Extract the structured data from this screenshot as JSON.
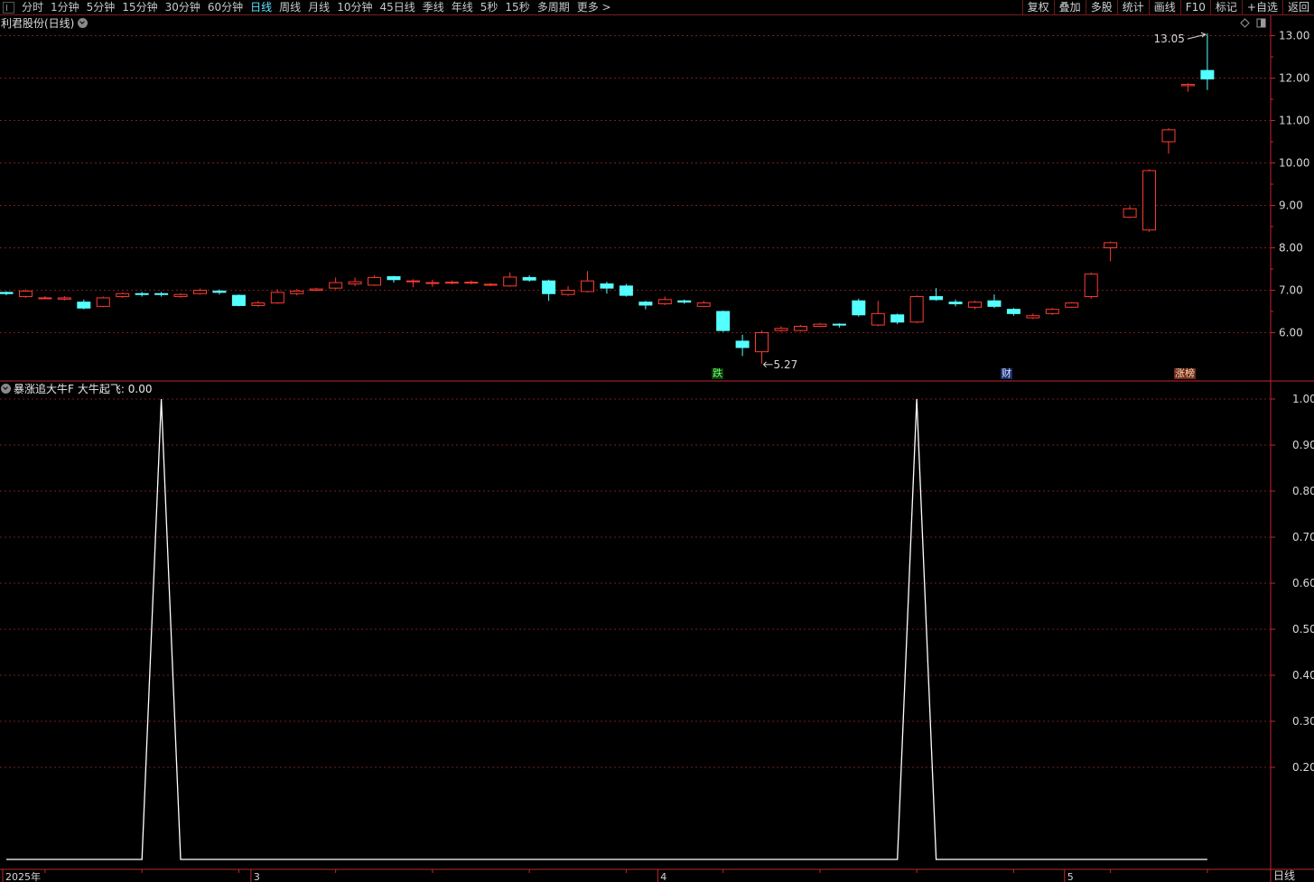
{
  "toolbar": {
    "periods": [
      "分时",
      "1分钟",
      "5分钟",
      "15分钟",
      "30分钟",
      "60分钟",
      "日线",
      "周线",
      "月线",
      "10分钟",
      "45日线",
      "季线",
      "年线",
      "5秒",
      "15秒",
      "多周期",
      "更多 >"
    ],
    "active_period": "日线",
    "buttons": [
      "复权",
      "叠加",
      "多股",
      "统计",
      "画线",
      "F10",
      "标记",
      "+自选",
      "返回"
    ]
  },
  "main_panel": {
    "title": "利君股份(日线)"
  },
  "indicator_panel": {
    "name": "暴涨追大牛F",
    "line_label": "大牛起飞: 0.00"
  },
  "bottom_period_label": "日线",
  "colors": {
    "up": "#ff3b30",
    "down": "#54ffff",
    "grid": "#7a1c1c",
    "axis": "#c0282b",
    "line": "#ffffff"
  },
  "chart_data": [
    {
      "type": "candlestick",
      "title": "利君股份(日线)",
      "ylim": [
        5.0,
        13.2
      ],
      "y_ticks": [
        "6.00",
        "7.00",
        "8.00",
        "9.00",
        "10.00",
        "11.00",
        "12.00",
        "13.00"
      ],
      "max_label": "13.05",
      "min_label": "5.27",
      "signals": [
        {
          "index": 37,
          "label": "跌"
        },
        {
          "index": 52,
          "label": "财"
        },
        {
          "index": 61,
          "label": "涨榜"
        }
      ],
      "candles": [
        [
          6.95,
          6.92,
          6.97,
          6.88
        ],
        [
          6.85,
          6.98,
          7.02,
          6.82
        ],
        [
          6.82,
          6.82,
          6.86,
          6.79
        ],
        [
          6.79,
          6.82,
          6.86,
          6.76
        ],
        [
          6.72,
          6.58,
          6.78,
          6.55
        ],
        [
          6.62,
          6.82,
          6.85,
          6.6
        ],
        [
          6.85,
          6.92,
          6.95,
          6.82
        ],
        [
          6.92,
          6.9,
          6.96,
          6.85
        ],
        [
          6.92,
          6.9,
          6.96,
          6.85
        ],
        [
          6.85,
          6.9,
          6.93,
          6.82
        ],
        [
          6.92,
          7.0,
          7.04,
          6.9
        ],
        [
          6.98,
          6.95,
          7.02,
          6.9
        ],
        [
          6.88,
          6.64,
          6.9,
          6.62
        ],
        [
          6.64,
          6.7,
          6.75,
          6.61
        ],
        [
          6.7,
          6.95,
          7.02,
          6.68
        ],
        [
          6.92,
          6.98,
          7.03,
          6.88
        ],
        [
          7.0,
          7.03,
          7.06,
          6.98
        ],
        [
          7.05,
          7.18,
          7.3,
          7.02
        ],
        [
          7.15,
          7.2,
          7.3,
          7.1
        ],
        [
          7.12,
          7.3,
          7.35,
          7.1
        ],
        [
          7.32,
          7.25,
          7.34,
          7.18
        ],
        [
          7.2,
          7.22,
          7.26,
          7.07
        ],
        [
          7.18,
          7.18,
          7.25,
          7.08
        ],
        [
          7.18,
          7.19,
          7.23,
          7.14
        ],
        [
          7.18,
          7.19,
          7.23,
          7.14
        ],
        [
          7.12,
          7.14,
          7.17,
          7.1
        ],
        [
          7.1,
          7.31,
          7.42,
          7.08
        ],
        [
          7.3,
          7.24,
          7.35,
          7.2
        ],
        [
          7.22,
          6.92,
          7.25,
          6.75
        ],
        [
          6.9,
          7.0,
          7.1,
          6.87
        ],
        [
          6.97,
          7.22,
          7.45,
          6.95
        ],
        [
          7.15,
          7.05,
          7.2,
          6.92
        ],
        [
          7.1,
          6.88,
          7.15,
          6.85
        ],
        [
          6.72,
          6.65,
          6.75,
          6.55
        ],
        [
          6.68,
          6.78,
          6.85,
          6.65
        ],
        [
          6.75,
          6.72,
          6.78,
          6.68
        ],
        [
          6.62,
          6.7,
          6.75,
          6.6
        ],
        [
          6.5,
          6.05,
          6.52,
          6.02
        ],
        [
          5.8,
          5.65,
          5.95,
          5.45
        ],
        [
          5.55,
          6.0,
          6.05,
          5.27
        ],
        [
          6.05,
          6.1,
          6.15,
          6.02
        ],
        [
          6.05,
          6.15,
          6.18,
          6.03
        ],
        [
          6.15,
          6.2,
          6.23,
          6.13
        ],
        [
          6.2,
          6.18,
          6.22,
          6.12
        ],
        [
          6.75,
          6.42,
          6.8,
          6.38
        ],
        [
          6.18,
          6.45,
          6.75,
          6.15
        ],
        [
          6.42,
          6.25,
          6.45,
          6.2
        ],
        [
          6.25,
          6.85,
          6.88,
          6.22
        ],
        [
          6.85,
          6.78,
          7.05,
          6.75
        ],
        [
          6.72,
          6.68,
          6.78,
          6.62
        ],
        [
          6.6,
          6.72,
          6.75,
          6.55
        ],
        [
          6.75,
          6.62,
          6.9,
          6.58
        ],
        [
          6.55,
          6.45,
          6.58,
          6.4
        ],
        [
          6.35,
          6.4,
          6.45,
          6.32
        ],
        [
          6.45,
          6.55,
          6.58,
          6.42
        ],
        [
          6.6,
          6.7,
          6.72,
          6.58
        ],
        [
          6.85,
          7.38,
          7.42,
          6.8
        ],
        [
          8.0,
          8.12,
          8.15,
          7.68
        ],
        [
          8.72,
          8.92,
          8.98,
          8.7
        ],
        [
          8.42,
          9.82,
          9.85,
          8.38
        ],
        [
          10.5,
          10.78,
          10.82,
          10.22
        ],
        [
          11.82,
          11.85,
          11.88,
          11.68
        ],
        [
          12.18,
          11.98,
          13.05,
          11.72
        ]
      ]
    },
    {
      "type": "line",
      "title": "暴涨追大牛F",
      "series": [
        {
          "name": "大牛起飞",
          "values": [
            0,
            0,
            0,
            0,
            0,
            0,
            0,
            0,
            1,
            0,
            0,
            0,
            0,
            0,
            0,
            0,
            0,
            0,
            0,
            0,
            0,
            0,
            0,
            0,
            0,
            0,
            0,
            0,
            0,
            0,
            0,
            0,
            0,
            0,
            0,
            0,
            0,
            0,
            0,
            0,
            0,
            0,
            0,
            0,
            0,
            0,
            0,
            1,
            0,
            0,
            0,
            0,
            0,
            0,
            0,
            0,
            0,
            0,
            0,
            0,
            0,
            0,
            0
          ]
        }
      ],
      "ylim": [
        0,
        1.0
      ],
      "y_ticks": [
        "0.20",
        "0.30",
        "0.40",
        "0.50",
        "0.60",
        "0.70",
        "0.80",
        "0.90",
        "1.00"
      ],
      "x_tick_labels": [
        "2025年",
        "3",
        "4",
        "5"
      ]
    }
  ]
}
